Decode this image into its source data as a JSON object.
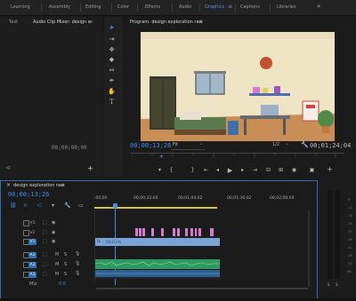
{
  "workspaces": {
    "tabs": [
      "Learning",
      "Assembly",
      "Editing",
      "Color",
      "Effects",
      "Audio",
      "Graphics",
      "Captions",
      "Libraries"
    ],
    "active": "Graphics",
    "more": "»"
  },
  "left_panel": {
    "tabs": [
      "Text",
      "Audio Clip Mixer: design e"
    ],
    "menu_glyph": "≡",
    "timecode": "00;00;00;00"
  },
  "program_monitor": {
    "title": "Program: design exploration raw",
    "menu_glyph": "≡",
    "current_time": "00;00;13;26",
    "fit_label": "Fit",
    "resolution": "1/2",
    "duration": "00;01;24;04"
  },
  "timeline": {
    "close_glyph": "×",
    "sequence_name": "design exploration raw",
    "menu_glyph": "≡",
    "timecode": "00;00;13;26",
    "ruler_labels": [
      ":00;00",
      "00;00;32;00",
      "00;01;04;02",
      "00;01;36;02",
      "00;02;08;04"
    ],
    "video_tracks": [
      {
        "target": "V3",
        "name": "V3"
      },
      {
        "target": "V2",
        "name": "V2"
      },
      {
        "target": "V1",
        "name": "V1"
      }
    ],
    "audio_tracks": [
      {
        "target": "A1",
        "name": "A1",
        "m": "M",
        "s": "S"
      },
      {
        "target": "A2",
        "name": "A2",
        "m": "M",
        "s": "S"
      },
      {
        "target": "A3",
        "name": "A3",
        "m": "M",
        "s": "S"
      }
    ],
    "mix_label": "Mix",
    "mix_value": "0.0",
    "v1_clip_label": "[Vid1].fx"
  },
  "audio_meter": {
    "labels": [
      "-6",
      "-12",
      "-18",
      "-24",
      "-30",
      "-36",
      "-42",
      "-48",
      "-54",
      "dB"
    ],
    "solo": [
      "S",
      "S"
    ]
  },
  "colors": {
    "accent": "#3d8ff2",
    "playhead": "#3d8ff2",
    "video_clip": "#7aa3d6",
    "audio_clip": "#2e9a62",
    "graphic_clip": "#d47ad0"
  },
  "icons": {
    "tools": [
      "selection-tool-icon",
      "track-select-icon",
      "ripple-edit-icon",
      "razor-icon",
      "slip-icon",
      "pen-icon",
      "hand-icon",
      "type-tool-icon"
    ]
  }
}
